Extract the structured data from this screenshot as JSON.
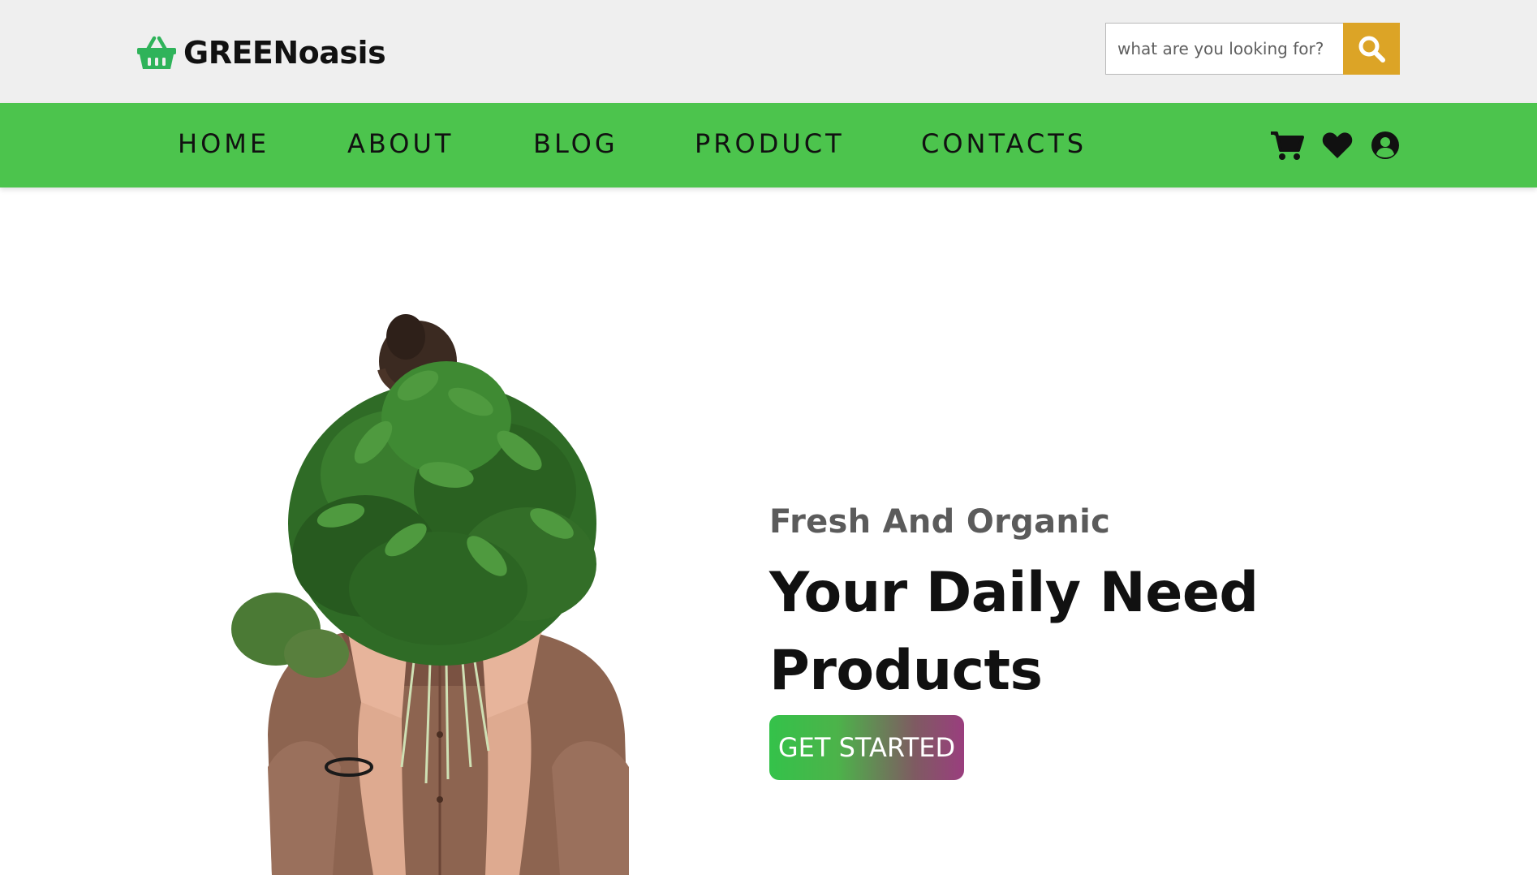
{
  "brand": {
    "name": "GREENoasis",
    "icon": "basket-icon",
    "icon_color": "#2fb35a"
  },
  "search": {
    "placeholder": "what are you looking for?",
    "value": "",
    "button_icon": "search-icon",
    "button_color": "#dca426"
  },
  "nav": {
    "background": "#4cc44d",
    "items": [
      {
        "label": "HOME"
      },
      {
        "label": "ABOUT"
      },
      {
        "label": "BLOG"
      },
      {
        "label": "PRODUCT"
      },
      {
        "label": "CONTACTS"
      }
    ],
    "icons": [
      "cart-icon",
      "heart-icon",
      "user-icon"
    ]
  },
  "hero": {
    "subtitle": "Fresh And Organic",
    "title_line1": "Your Daily Need",
    "title_line2": "Products",
    "cta_label": "GET STARTED",
    "image": "woman-holding-greens-image"
  }
}
